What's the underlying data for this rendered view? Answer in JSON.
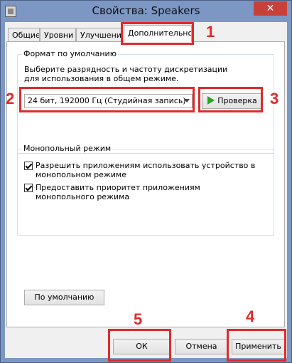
{
  "window": {
    "title": "Свойства: Speakers",
    "close": "✕"
  },
  "tabs": [
    {
      "label": "Общие"
    },
    {
      "label": "Уровни"
    },
    {
      "label": "Улучшения"
    },
    {
      "label": "Дополнительно"
    }
  ],
  "default_format": {
    "group_title": "Формат по умолчанию",
    "description": "Выберите разрядность и частоту дискретизации для использования в общем режиме.",
    "selected": "24 бит, 192000 Гц (Студийная запись)",
    "test_button": "Проверка"
  },
  "exclusive_mode": {
    "group_title": "Монопольный режим",
    "options": [
      {
        "label": "Разрешить приложениям использовать устройство в монопольном режиме",
        "checked": true
      },
      {
        "label": "Предоставить приоритет приложениям монопольного режима",
        "checked": true
      }
    ]
  },
  "restore_defaults": "По умолчанию",
  "footer": {
    "ok": "ОК",
    "cancel": "Отмена",
    "apply": "Применить"
  },
  "annotations": {
    "n1": "1",
    "n2": "2",
    "n3": "3",
    "n4": "4",
    "n5": "5",
    "color": "#e02a2a"
  }
}
